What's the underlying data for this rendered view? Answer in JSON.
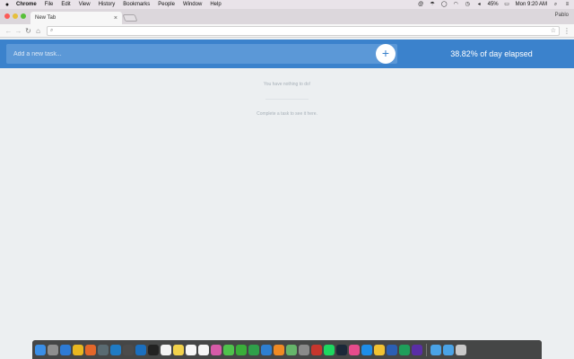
{
  "menubar": {
    "app": "Chrome",
    "menus": [
      "File",
      "Edit",
      "View",
      "History",
      "Bookmarks",
      "People",
      "Window",
      "Help"
    ],
    "battery": "45%",
    "clock": "Mon 9:20 AM"
  },
  "browser": {
    "tab_title": "New Tab",
    "tab_close": "×",
    "profile": "Pablo",
    "omnibox_value": ""
  },
  "app": {
    "task_placeholder": "Add a new task...",
    "add_label": "+",
    "elapsed_text": "38.82% of day elapsed",
    "empty_message": "You have nothing to do!",
    "hint_message": "Complete a task to see it here.",
    "accent_color": "#3b82cc"
  },
  "dock": {
    "icons": [
      {
        "name": "finder-icon",
        "color": "#3a8ee6"
      },
      {
        "name": "launchpad-icon",
        "color": "#8f8f8f"
      },
      {
        "name": "safari-icon",
        "color": "#2d7bd6"
      },
      {
        "name": "chrome-icon",
        "color": "#e8b720"
      },
      {
        "name": "firefox-icon",
        "color": "#e4672a"
      },
      {
        "name": "atom-icon",
        "color": "#5a6b72"
      },
      {
        "name": "vscode-icon",
        "color": "#1f7bc4"
      },
      {
        "name": "sublime-icon",
        "color": "#4b4b4b"
      },
      {
        "name": "xcode-icon",
        "color": "#1b6fbf"
      },
      {
        "name": "terminal-icon",
        "color": "#222222"
      },
      {
        "name": "calendar-icon",
        "color": "#f4f4f4"
      },
      {
        "name": "notes-icon",
        "color": "#f2d24c"
      },
      {
        "name": "reminders-icon",
        "color": "#f7f7f7"
      },
      {
        "name": "stickies-icon",
        "color": "#f5f5f5"
      },
      {
        "name": "photos-icon",
        "color": "#d65ba8"
      },
      {
        "name": "messages-icon",
        "color": "#4fc24c"
      },
      {
        "name": "facetime-icon",
        "color": "#3aae3a"
      },
      {
        "name": "numbers-icon",
        "color": "#2fa04a"
      },
      {
        "name": "keynote-icon",
        "color": "#2e7fd1"
      },
      {
        "name": "ibooks-icon",
        "color": "#ef8a24"
      },
      {
        "name": "maps-icon",
        "color": "#65b56a"
      },
      {
        "name": "system-preferences-icon",
        "color": "#8a8a8a"
      },
      {
        "name": "filezilla-icon",
        "color": "#c7362d"
      },
      {
        "name": "spotify-icon",
        "color": "#1ed760"
      },
      {
        "name": "steam-icon",
        "color": "#1b2838"
      },
      {
        "name": "itunes-icon",
        "color": "#e64c8c"
      },
      {
        "name": "app-store-icon",
        "color": "#1e8ee8"
      },
      {
        "name": "emoji-icon",
        "color": "#f1c232"
      },
      {
        "name": "word-icon",
        "color": "#2b5fb4"
      },
      {
        "name": "hangouts-icon",
        "color": "#1e9e5a"
      },
      {
        "name": "siri-icon",
        "color": "#5a2ea6"
      },
      {
        "name": "folder-icon",
        "color": "#4aa3e6"
      },
      {
        "name": "downloads-icon",
        "color": "#4aa3e6"
      },
      {
        "name": "trash-icon",
        "color": "#c9c9c9"
      }
    ]
  }
}
